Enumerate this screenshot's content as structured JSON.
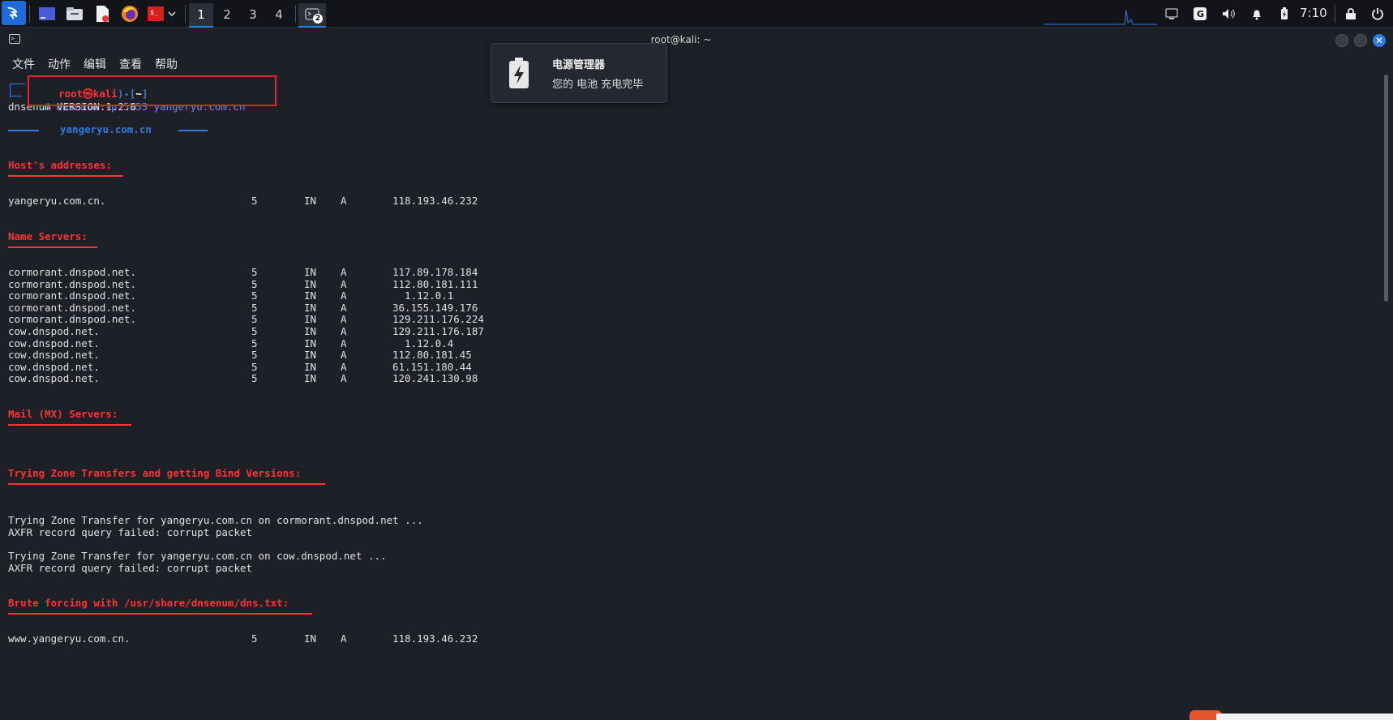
{
  "taskbar": {
    "workspaces": [
      "1",
      "2",
      "3",
      "4"
    ],
    "active_workspace": "1",
    "terminal_badge": "2",
    "clock": "7:10"
  },
  "window": {
    "title": "root@kali: ~",
    "menu": [
      "文件",
      "动作",
      "编辑",
      "查看",
      "帮助"
    ]
  },
  "notification": {
    "title": "电源管理器",
    "body": "您的 电池 充电完毕"
  },
  "terminal": {
    "prompt_user": "root㉿kali",
    "prompt_dir": "~",
    "prompt_symbol": "#",
    "command": "dnsenum -p 5353 yangeryu.com.cn",
    "version_line": "dnsenum VERSION:1.2.6",
    "domain_banner": "yangeryu.com.cn",
    "host_section": "Host's addresses:",
    "host_records": [
      {
        "name": "yangeryu.com.cn.",
        "ttl": "5",
        "class": "IN",
        "type": "A",
        "ip": "118.193.46.232"
      }
    ],
    "ns_section": "Name Servers:",
    "ns_records": [
      {
        "name": "cormorant.dnspod.net.",
        "ttl": "5",
        "class": "IN",
        "type": "A",
        "ip": "117.89.178.184"
      },
      {
        "name": "cormorant.dnspod.net.",
        "ttl": "5",
        "class": "IN",
        "type": "A",
        "ip": "112.80.181.111"
      },
      {
        "name": "cormorant.dnspod.net.",
        "ttl": "5",
        "class": "IN",
        "type": "A",
        "ip": "  1.12.0.1"
      },
      {
        "name": "cormorant.dnspod.net.",
        "ttl": "5",
        "class": "IN",
        "type": "A",
        "ip": "36.155.149.176"
      },
      {
        "name": "cormorant.dnspod.net.",
        "ttl": "5",
        "class": "IN",
        "type": "A",
        "ip": "129.211.176.224"
      },
      {
        "name": "cow.dnspod.net.",
        "ttl": "5",
        "class": "IN",
        "type": "A",
        "ip": "129.211.176.187"
      },
      {
        "name": "cow.dnspod.net.",
        "ttl": "5",
        "class": "IN",
        "type": "A",
        "ip": "  1.12.0.4"
      },
      {
        "name": "cow.dnspod.net.",
        "ttl": "5",
        "class": "IN",
        "type": "A",
        "ip": "112.80.181.45"
      },
      {
        "name": "cow.dnspod.net.",
        "ttl": "5",
        "class": "IN",
        "type": "A",
        "ip": "61.151.180.44"
      },
      {
        "name": "cow.dnspod.net.",
        "ttl": "5",
        "class": "IN",
        "type": "A",
        "ip": "120.241.130.98"
      }
    ],
    "mx_section": "Mail (MX) Servers:",
    "zone_section": "Trying Zone Transfers and getting Bind Versions:",
    "zone_lines": [
      "Trying Zone Transfer for yangeryu.com.cn on cormorant.dnspod.net ...",
      "AXFR record query failed: corrupt packet",
      "Trying Zone Transfer for yangeryu.com.cn on cow.dnspod.net ...",
      "AXFR record query failed: corrupt packet"
    ],
    "brute_section": "Brute forcing with /usr/share/dnsenum/dns.txt:",
    "brute_records": [
      {
        "name": "www.yangeryu.com.cn.",
        "ttl": "5",
        "class": "IN",
        "type": "A",
        "ip": "118.193.46.232"
      }
    ]
  }
}
